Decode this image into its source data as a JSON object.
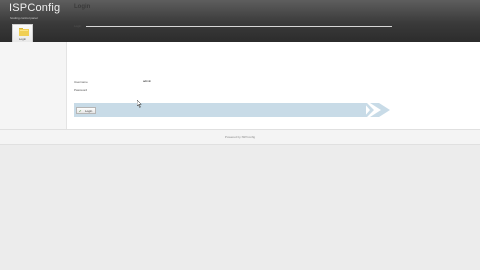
{
  "header": {
    "brand": "ISPConfig",
    "subtitle": "hosting control panel"
  },
  "nav": {
    "tabs": [
      {
        "label": "Login",
        "icon": "folder-icon",
        "active": true
      }
    ]
  },
  "page": {
    "title": "Login",
    "form": {
      "legend": "Login",
      "username_label": "Username",
      "username_value": "admin",
      "password_label": "Password",
      "password_value": ""
    },
    "login_button_label": "Login"
  },
  "footer": {
    "text": "Powered by ISPConfig"
  },
  "colors": {
    "header_dark": "#3a3a3a",
    "action_bar": "#c8dbe7",
    "page_bg": "#ececec",
    "content_bg": "#ffffff"
  }
}
